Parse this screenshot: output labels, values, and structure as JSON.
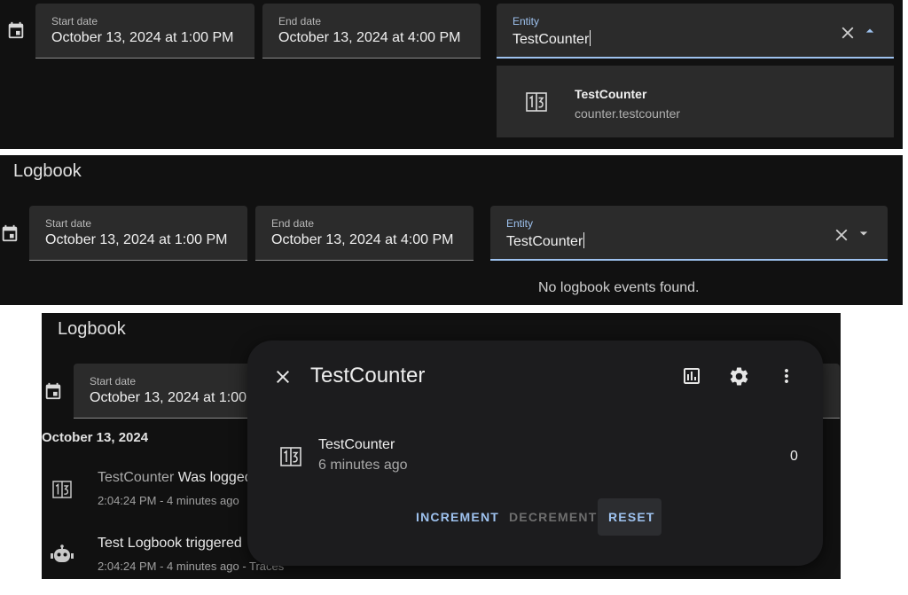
{
  "shared": {
    "start_label": "Start date",
    "start_value": "October 13, 2024 at 1:00 PM",
    "start_value_truncated": "October 13, 2024 at 1:00",
    "end_label": "End date",
    "end_value": "October 13, 2024 at 4:00 PM",
    "entity_label": "Entity",
    "entity_value": "TestCounter"
  },
  "panel1": {
    "suggestion": {
      "name": "TestCounter",
      "entity_id": "counter.testcounter"
    }
  },
  "panel2": {
    "title": "Logbook",
    "empty_message": "No logbook events found."
  },
  "panel3": {
    "title": "Logbook",
    "date_header": "October 13, 2024",
    "entries": [
      {
        "entity": "TestCounter",
        "action": "Was logged",
        "meta": "2:04:24 PM - 4 minutes ago"
      },
      {
        "entity": "Test Logbook triggered",
        "action": "",
        "meta": "2:04:24 PM - 4 minutes ago - Traces"
      }
    ],
    "dialog": {
      "title": "TestCounter",
      "entity_name": "TestCounter",
      "last_changed": "6 minutes ago",
      "state": "0",
      "buttons": {
        "increment": "INCREMENT",
        "decrement": "DECREMENT",
        "reset": "RESET"
      }
    }
  },
  "colors": {
    "accent": "#9ec2ef",
    "background": "#111111",
    "field": "#2b2b2b",
    "dialog": "#1c1c1e"
  },
  "icons": [
    "calendar-icon",
    "counter-icon",
    "close-icon",
    "chevron-up-icon",
    "chevron-down-icon",
    "history-icon",
    "gear-icon",
    "more-vert-icon",
    "robot-icon"
  ]
}
